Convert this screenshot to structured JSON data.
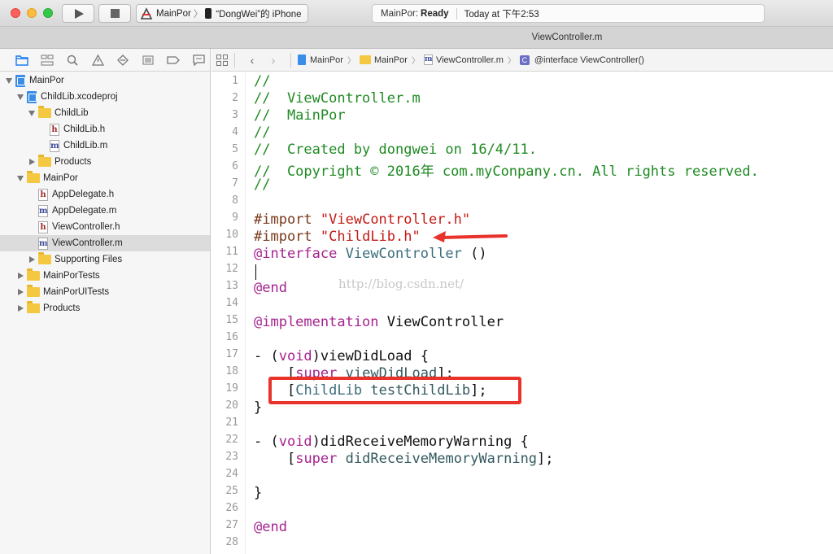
{
  "toolbar": {
    "scheme_name": "MainPor",
    "device_name": "“DongWei”的 iPhone",
    "activity_name": "MainPor:",
    "activity_state": "Ready",
    "activity_time": "Today at 下午2:53"
  },
  "tab": {
    "title": "ViewController.m"
  },
  "navigator": {
    "icons": [
      "folder-icon",
      "symbol-icon",
      "search-icon",
      "warning-icon",
      "test-icon",
      "debug-icon",
      "breakpoint-icon",
      "report-icon"
    ],
    "tree": [
      {
        "label": "MainPor"
      },
      {
        "label": "ChildLib.xcodeproj"
      },
      {
        "label": "ChildLib"
      },
      {
        "label": "ChildLib.h"
      },
      {
        "label": "ChildLib.m"
      },
      {
        "label": "Products"
      },
      {
        "label": "MainPor"
      },
      {
        "label": "AppDelegate.h"
      },
      {
        "label": "AppDelegate.m"
      },
      {
        "label": "ViewController.h"
      },
      {
        "label": "ViewController.m"
      },
      {
        "label": "Supporting Files"
      },
      {
        "label": "MainPorTests"
      },
      {
        "label": "MainPorUITests"
      },
      {
        "label": "Products"
      }
    ],
    "selected": "ViewController.m"
  },
  "jumpbar": {
    "crumbs": [
      "MainPor",
      "MainPor",
      "ViewController.m",
      "@interface ViewController()"
    ]
  },
  "editor": {
    "line_numbers": [
      "1",
      "2",
      "3",
      "4",
      "5",
      "6",
      "7",
      "8",
      "9",
      "10",
      "11",
      "12",
      "13",
      "14",
      "15",
      "16",
      "17",
      "18",
      "19",
      "20",
      "21",
      "22",
      "23",
      "24",
      "25",
      "26",
      "27",
      "28"
    ],
    "lines": {
      "l1": "//",
      "l2": "//  ViewController.m",
      "l3": "//  MainPor",
      "l4": "//",
      "l5": "//  Created by dongwei on 16/4/11.",
      "l6": "//  Copyright © 2016年 com.myConpany.cn. All rights reserved.",
      "l7": "//",
      "l9_pre": "#import",
      "l9_str": "\"ViewController.h\"",
      "l10_pre": "#import",
      "l10_str": "\"ChildLib.h\"",
      "l11_kw": "@interface",
      "l11_cls": "ViewController",
      "l11_rest": "()",
      "l13_kw": "@end",
      "l15_kw": "@implementation",
      "l15_rest": "ViewController",
      "l17_a": "- (",
      "l17_kw": "void",
      "l17_b": ")viewDidLoad {",
      "l18_a": "[",
      "l18_kw": "super",
      "l18_call": "viewDidLoad",
      "l18_b": "];",
      "l19_a": "[",
      "l19_cls": "ChildLib",
      "l19_call": "testChildLib",
      "l19_b": "];",
      "l20": "}",
      "l22_a": "- (",
      "l22_kw": "void",
      "l22_b": ")didReceiveMemoryWarning {",
      "l23_a": "[",
      "l23_kw": "super",
      "l23_call": "didReceiveMemoryWarning",
      "l23_b": "];",
      "l25": "}",
      "l27_kw": "@end"
    },
    "watermark": "http://blog.csdn.net/"
  },
  "colors": {
    "comment": "#1f8a22",
    "string": "#c41a16",
    "keyword": "#a5228f",
    "annotation": "#e8322a"
  }
}
